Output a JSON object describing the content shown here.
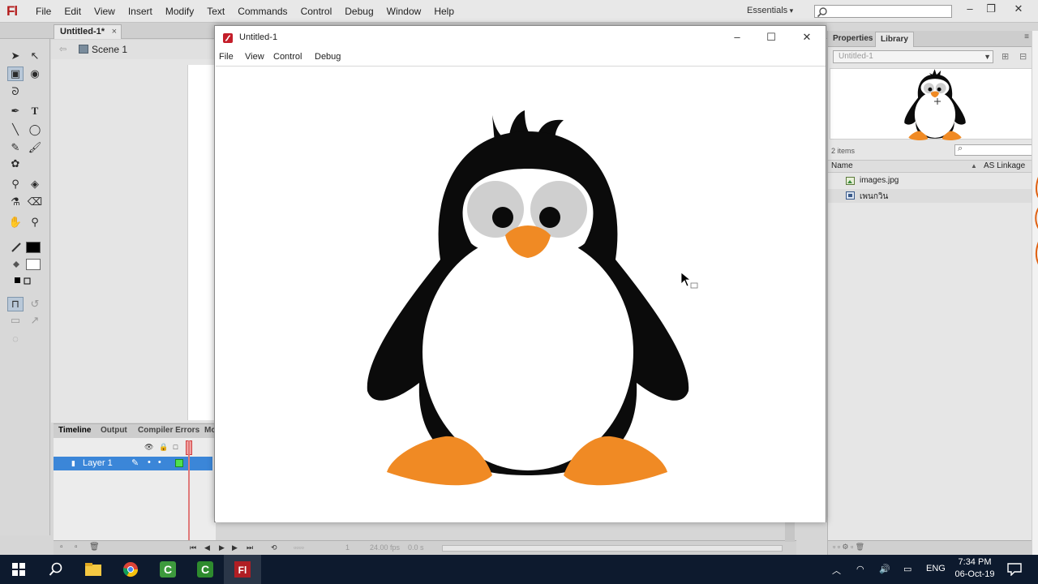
{
  "app": {
    "logo": "Fl",
    "menu": [
      "File",
      "Edit",
      "View",
      "Insert",
      "Modify",
      "Text",
      "Commands",
      "Control",
      "Debug",
      "Window",
      "Help"
    ],
    "workspace": "Essentials",
    "window_controls": [
      "–",
      "❐",
      "✕"
    ]
  },
  "document": {
    "tab_label": "Untitled-1*",
    "tab_close": "×",
    "scene_label": "Scene 1"
  },
  "tools": [
    {
      "icon": "selection-arrow-icon",
      "glyph": "➤"
    },
    {
      "icon": "subselection-icon",
      "glyph": "↖"
    },
    {
      "icon": "free-transform-icon",
      "glyph": "▣"
    },
    {
      "icon": "3d-rotation-icon",
      "glyph": "◉"
    },
    {
      "icon": "lasso-icon",
      "glyph": "ᘐ"
    },
    {
      "icon": "pen-icon",
      "glyph": "✒"
    },
    {
      "icon": "text-icon",
      "glyph": "T"
    },
    {
      "icon": "line-icon",
      "glyph": "╲"
    },
    {
      "icon": "oval-icon",
      "glyph": "◯"
    },
    {
      "icon": "pencil-icon",
      "glyph": "✎"
    },
    {
      "icon": "brush-icon",
      "glyph": "🖌"
    },
    {
      "icon": "deco-icon",
      "glyph": "✿"
    },
    {
      "icon": "bone-icon",
      "glyph": "⚲"
    },
    {
      "icon": "paint-bucket-icon",
      "glyph": "◈"
    },
    {
      "icon": "eyedropper-icon",
      "glyph": "⚗"
    },
    {
      "icon": "eraser-icon",
      "glyph": "⌫"
    },
    {
      "icon": "hand-icon",
      "glyph": "✋"
    },
    {
      "icon": "zoom-icon",
      "glyph": "⚲"
    }
  ],
  "colors": {
    "stroke": "#000000",
    "fill": "#ffffff",
    "layer_highlight": "#3b86d8",
    "taskbar": "#0d1a2e",
    "penguin_body": "#0b0b0b",
    "penguin_orange": "#f08a24",
    "penguin_eye_patch": "#cfcfcf"
  },
  "timeline": {
    "tabs": [
      "Timeline",
      "Output",
      "Compiler Errors",
      "Mo"
    ],
    "layer_name": "Layer 1",
    "fps": "24.00 fps",
    "time": "0.0 s",
    "frame": "1"
  },
  "library": {
    "tabs": [
      "Properties",
      "Library"
    ],
    "document_select": "Untitled-1",
    "items_count": "2 items",
    "columns": {
      "name": "Name",
      "linkage": "AS Linkage"
    },
    "items": [
      {
        "label": "images.jpg",
        "icon": "bitmap-icon"
      },
      {
        "label": "เพนกวิน",
        "icon": "movieclip-icon"
      }
    ]
  },
  "player": {
    "title": "Untitled-1",
    "menu": [
      "File",
      "View",
      "Control",
      "Debug"
    ],
    "controls": [
      "–",
      "☐",
      "✕"
    ]
  },
  "taskbar": {
    "apps": [
      "start-icon",
      "search-icon",
      "file-explorer-icon",
      "chrome-icon",
      "camtasia-icon",
      "camtasia-icon",
      "flash-icon"
    ],
    "lang": "ENG",
    "time": "7:34 PM",
    "date": "06-Oct-19"
  }
}
